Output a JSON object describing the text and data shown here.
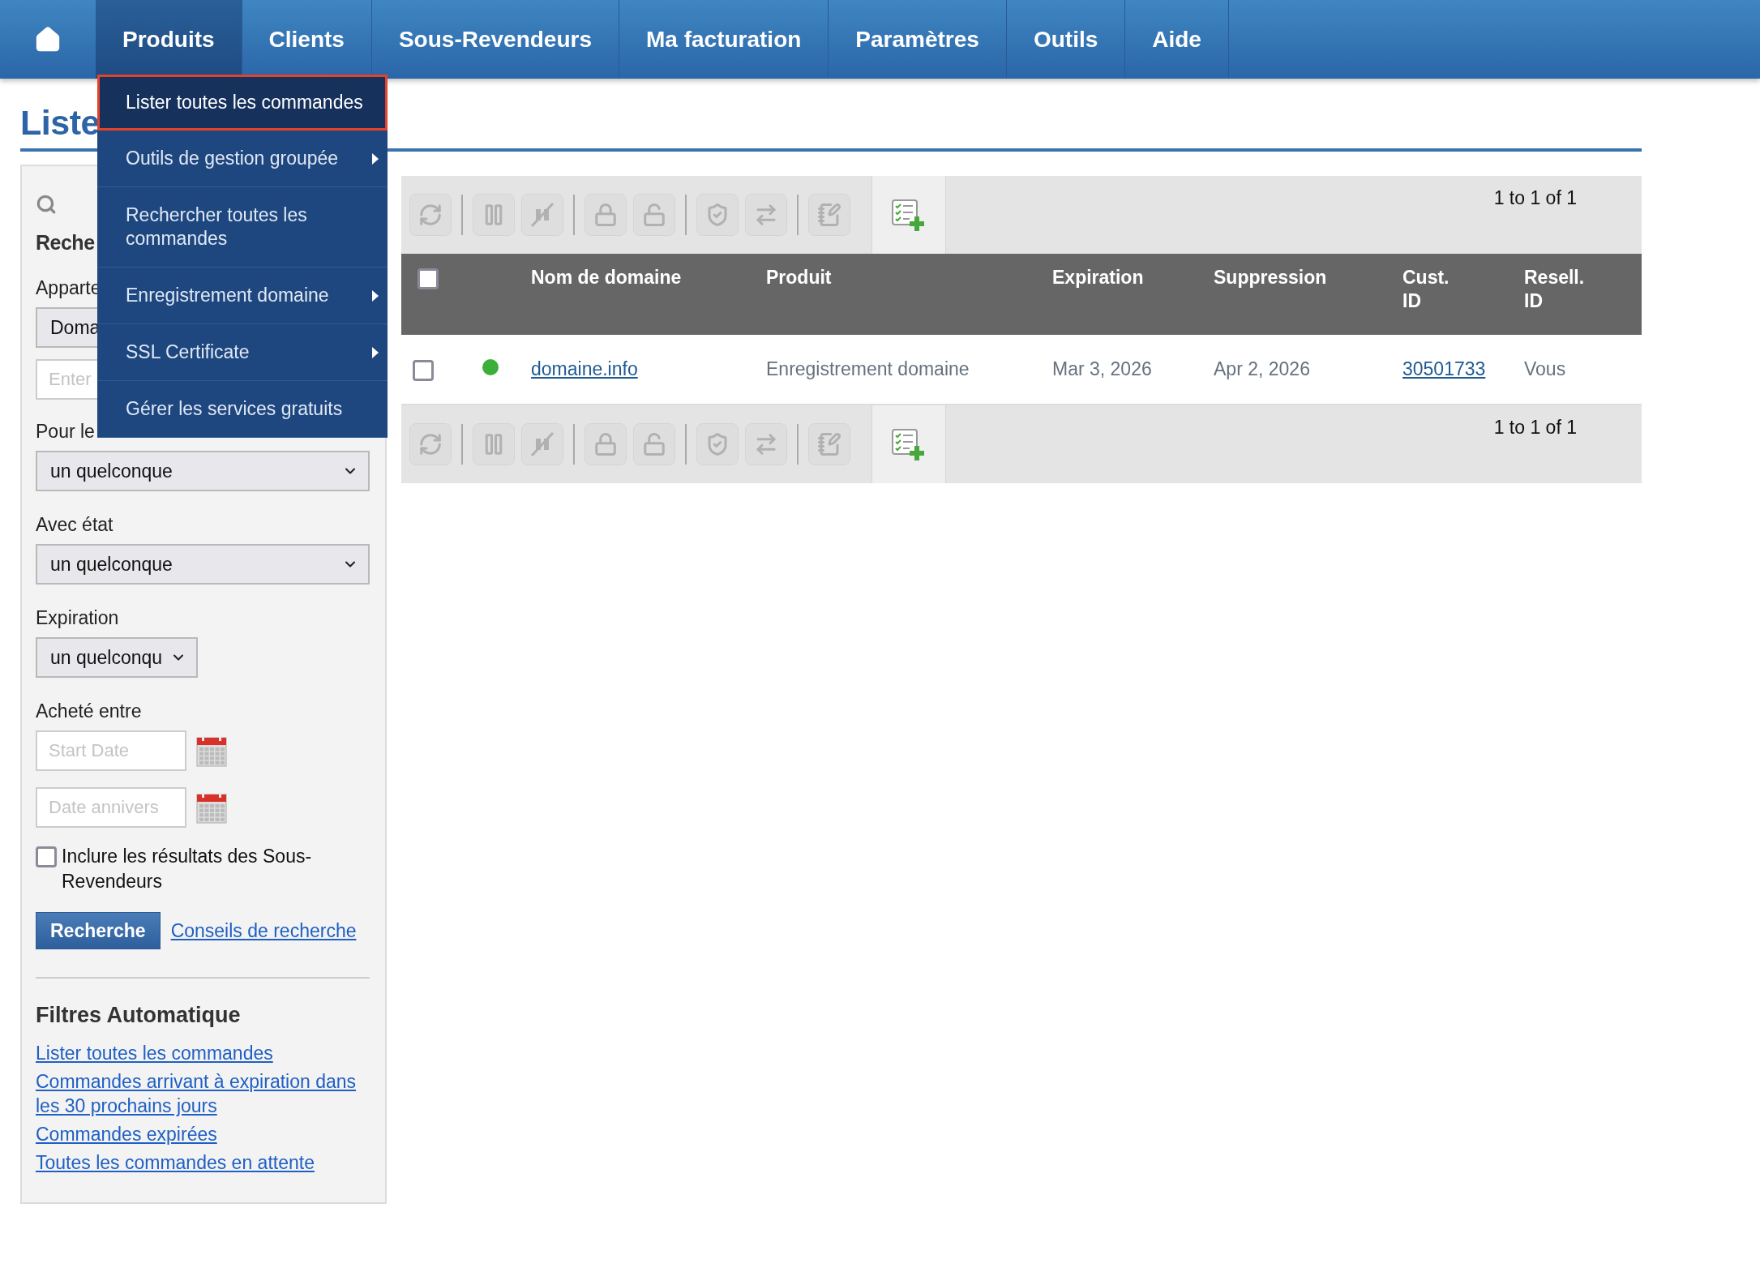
{
  "nav": {
    "items": [
      {
        "label": "Produits",
        "selected": true
      },
      {
        "label": "Clients",
        "selected": false
      },
      {
        "label": "Sous-Revendeurs",
        "selected": false
      },
      {
        "label": "Ma facturation",
        "selected": false
      },
      {
        "label": "Paramètres",
        "selected": false
      },
      {
        "label": "Outils",
        "selected": false
      },
      {
        "label": "Aide",
        "selected": false
      }
    ]
  },
  "dropdown": {
    "items": [
      {
        "label": "Lister toutes les commandes",
        "selected": true,
        "submenu": false
      },
      {
        "label": "Outils de gestion groupée",
        "selected": false,
        "submenu": true
      },
      {
        "label": "Rechercher toutes les commandes",
        "selected": false,
        "submenu": false
      },
      {
        "label": "Enregistrement domaine",
        "selected": false,
        "submenu": true
      },
      {
        "label": "SSL Certificate",
        "selected": false,
        "submenu": true
      },
      {
        "label": "Gérer les services gratuits",
        "selected": false,
        "submenu": false
      }
    ]
  },
  "page_title": "Liste",
  "sidebar": {
    "heading": "Reche",
    "fields": [
      {
        "kind": "label",
        "text": "Apparte"
      },
      {
        "kind": "select-covered",
        "value": "Doma"
      },
      {
        "kind": "input",
        "placeholder": "Enter"
      },
      {
        "kind": "label",
        "text": "Pour le"
      },
      {
        "kind": "select",
        "value": "un quelconque"
      },
      {
        "kind": "label",
        "text": "Avec état"
      },
      {
        "kind": "select",
        "value": "un quelconque"
      },
      {
        "kind": "label",
        "text": "Expiration"
      },
      {
        "kind": "select-small",
        "value": "un quelconqu"
      },
      {
        "kind": "label",
        "text": "Acheté entre"
      },
      {
        "kind": "date",
        "placeholder": "Start Date"
      },
      {
        "kind": "date",
        "placeholder": "Date annivers"
      },
      {
        "kind": "checkbox",
        "text": "Inclure les résultats des Sous-Revendeurs",
        "checked": false
      }
    ],
    "search_button": "Recherche",
    "tips_link": "Conseils de recherche",
    "filters": {
      "title": "Filtres Automatique",
      "links": [
        "Lister toutes les commandes",
        "Commandes arrivant à expiration dans les 30 prochains jours",
        "Commandes expirées",
        "Toutes les commandes en attente"
      ]
    }
  },
  "toolbars": [
    {
      "pagination": "1 to 1 of 1",
      "tools": [
        {
          "kind": "refresh",
          "disabled": true
        },
        {
          "kind": "pause",
          "disabled": true
        },
        {
          "kind": "unpause",
          "disabled": true
        },
        {
          "kind": "lock",
          "disabled": true
        },
        {
          "kind": "unlock",
          "disabled": true
        },
        {
          "kind": "protect",
          "disabled": true
        },
        {
          "kind": "transfer",
          "disabled": true
        },
        {
          "kind": "edit",
          "disabled": true
        },
        {
          "kind": "add",
          "disabled": false
        }
      ]
    },
    {
      "pagination": "1 to 1 of 1",
      "tools": [
        {
          "kind": "refresh",
          "disabled": true
        },
        {
          "kind": "pause",
          "disabled": true
        },
        {
          "kind": "unpause",
          "disabled": true
        },
        {
          "kind": "lock",
          "disabled": true
        },
        {
          "kind": "unlock",
          "disabled": true
        },
        {
          "kind": "protect",
          "disabled": true
        },
        {
          "kind": "transfer",
          "disabled": true
        },
        {
          "kind": "edit",
          "disabled": true
        },
        {
          "kind": "add",
          "disabled": false
        }
      ]
    }
  ],
  "table": {
    "header_checked": false,
    "columns": [
      "Nom de domaine",
      "Produit",
      "Expiration",
      "Suppression",
      "Cust. ID",
      "Resell. ID"
    ],
    "rows": [
      {
        "checked": false,
        "color": "#3cae3a",
        "domain": "domaine.info",
        "product": "Enregistrement domaine",
        "expiration": "Mar 3, 2026",
        "deletion": "Apr 2, 2026",
        "cust_id": "30501733",
        "resell_id": "Vous"
      }
    ]
  }
}
